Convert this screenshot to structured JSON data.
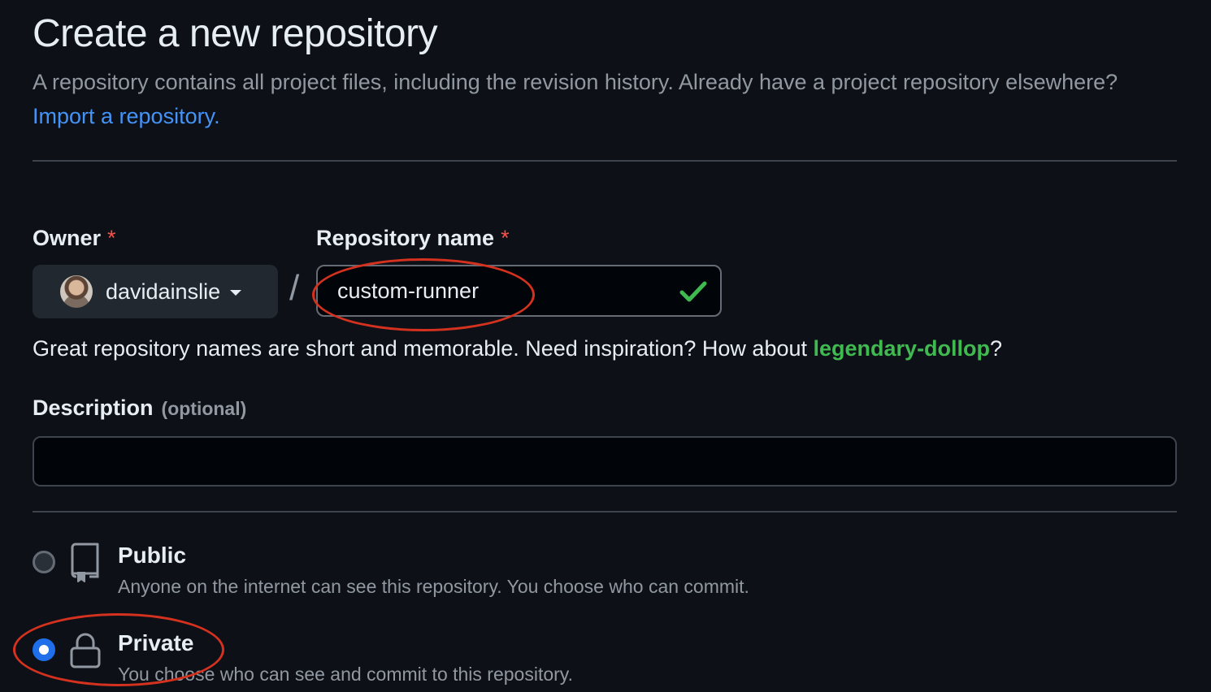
{
  "header": {
    "title": "Create a new repository",
    "subtitle": "A repository contains all project files, including the revision history. Already have a project repository elsewhere?",
    "import_link": "Import a repository."
  },
  "owner": {
    "label": "Owner",
    "required_mark": "*",
    "name": "davidainslie"
  },
  "separator": "/",
  "repo_name": {
    "label": "Repository name",
    "required_mark": "*",
    "value": "custom-runner"
  },
  "hint": {
    "text": "Great repository names are short and memorable. Need inspiration? How about",
    "suggestion": "legendary-dollop",
    "suffix": "?"
  },
  "description": {
    "label": "Description",
    "optional": "(optional)",
    "value": ""
  },
  "visibility": {
    "options": [
      {
        "title": "Public",
        "description": "Anyone on the internet can see this repository. You choose who can commit.",
        "icon": "repo-icon",
        "selected": false
      },
      {
        "title": "Private",
        "description": "You choose who can see and commit to this repository.",
        "icon": "lock-icon",
        "selected": true
      }
    ]
  },
  "colors": {
    "background": "#0d1117",
    "link": "#4493f8",
    "success": "#3fb950",
    "required": "#f85149",
    "annotation": "#d5311f",
    "radio_selected": "#1f6feb"
  }
}
